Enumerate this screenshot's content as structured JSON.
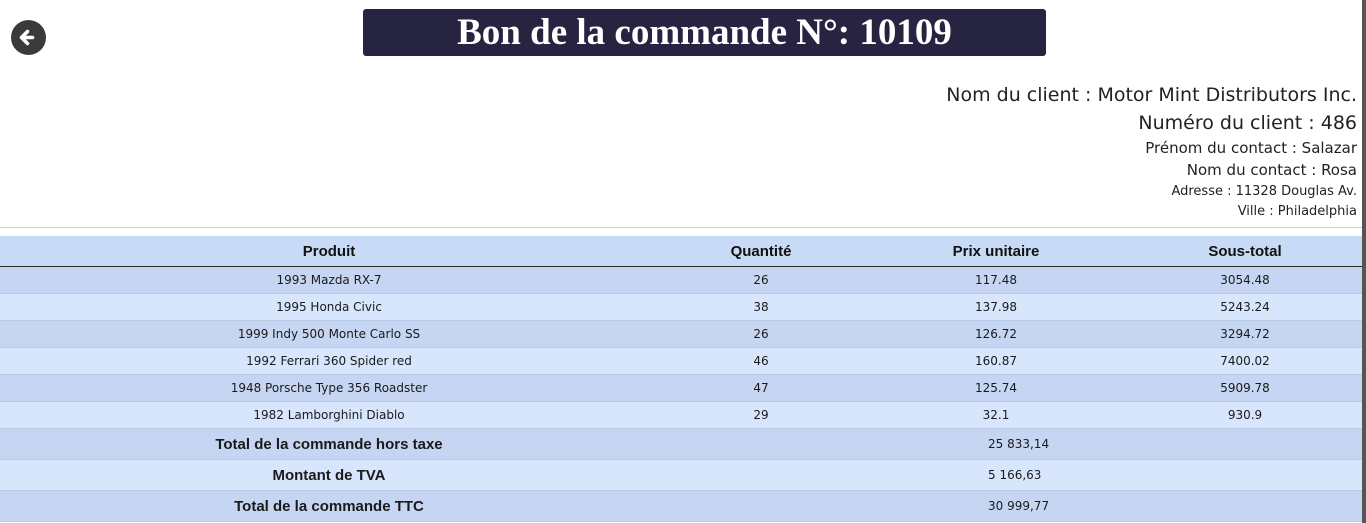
{
  "header": {
    "title": "Bon de la commande N°: 10109"
  },
  "client": {
    "name_line": "Nom du client : Motor Mint Distributors Inc.",
    "number_line": "Numéro du client : 486",
    "contact_first_line": "Prénom du contact : Salazar",
    "contact_last_line": "Nom du contact : Rosa",
    "address_line": "Adresse : 11328 Douglas Av.",
    "city_line": "Ville : Philadelphia"
  },
  "table": {
    "columns": [
      "Produit",
      "Quantité",
      "Prix unitaire",
      "Sous-total"
    ],
    "rows": [
      [
        "1993 Mazda RX-7",
        "26",
        "117.48",
        "3054.48"
      ],
      [
        "1995 Honda Civic",
        "38",
        "137.98",
        "5243.24"
      ],
      [
        "1999 Indy 500 Monte Carlo SS",
        "26",
        "126.72",
        "3294.72"
      ],
      [
        "1992 Ferrari 360 Spider red",
        "46",
        "160.87",
        "7400.02"
      ],
      [
        "1948 Porsche Type 356 Roadster",
        "47",
        "125.74",
        "5909.78"
      ],
      [
        "1982 Lamborghini Diablo",
        "29",
        "32.1",
        "930.9"
      ]
    ],
    "totals": [
      {
        "label": "Total de la commande hors taxe",
        "value": "25 833,14"
      },
      {
        "label": "Montant de TVA",
        "value": "5 166,63"
      },
      {
        "label": "Total de la commande TTC",
        "value": "30 999,77"
      }
    ]
  },
  "icons": {
    "back": "arrow-left-circle-icon"
  },
  "colors": {
    "banner_bg": "#272442",
    "row_dark": "#c6d6f2",
    "row_light": "#d7e6fd"
  }
}
